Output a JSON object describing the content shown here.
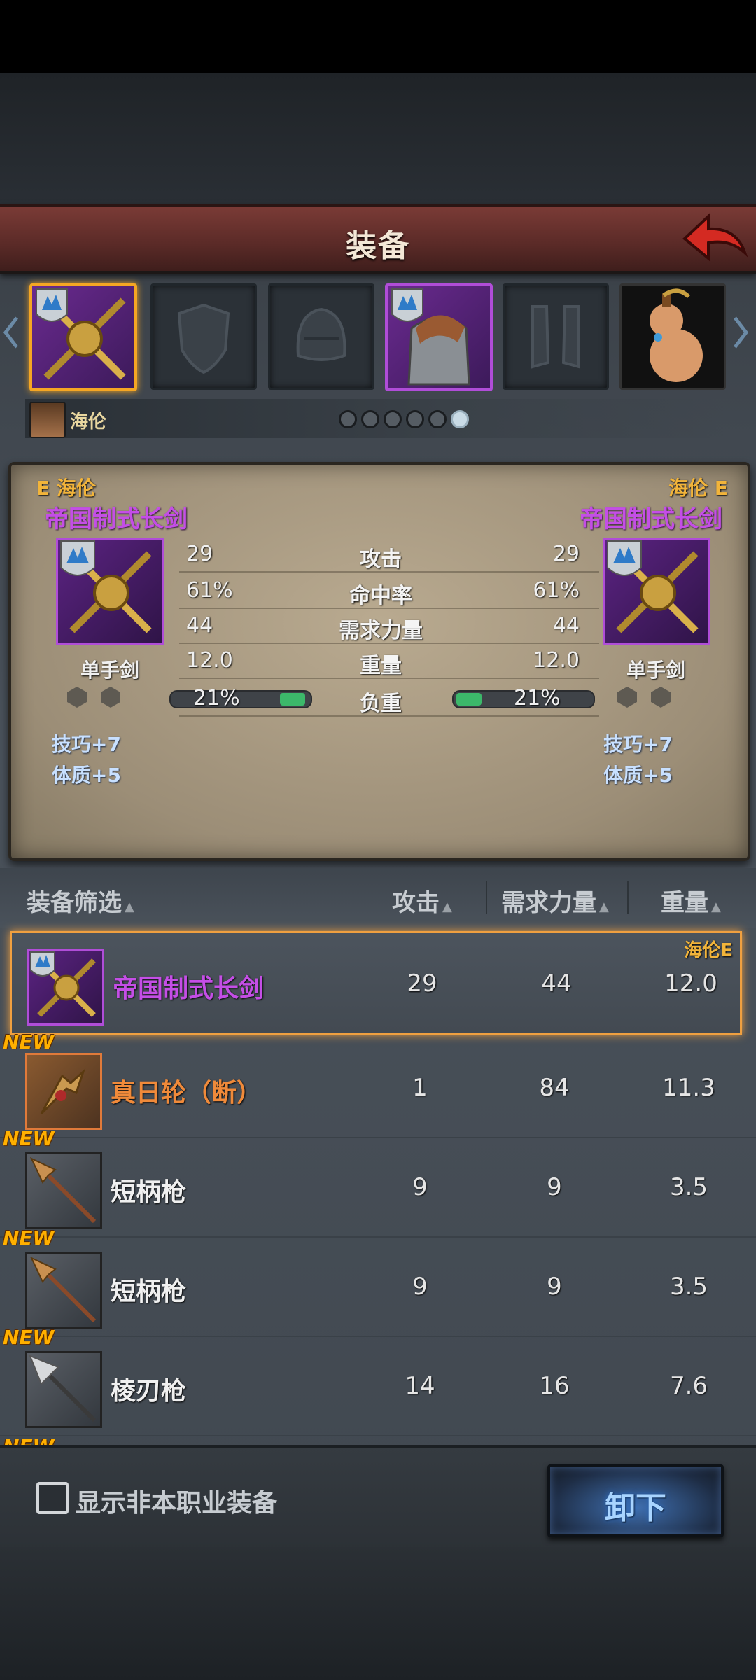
{
  "header": {
    "title": "装备"
  },
  "character": {
    "name": "海伦"
  },
  "pager": {
    "count": 6,
    "active": 5
  },
  "compare": {
    "left": {
      "tag": "E 海伦",
      "name": "帝国制式长剑",
      "type": "单手剑",
      "attack": "29",
      "hit": "61%",
      "str_req": "44",
      "weight": "12.0",
      "load": "21%",
      "bonus1": "技巧+7",
      "bonus2": "体质+5"
    },
    "right": {
      "tag": "海伦 E",
      "name": "帝国制式长剑",
      "type": "单手剑",
      "attack": "29",
      "hit": "61%",
      "str_req": "44",
      "weight": "12.0",
      "load": "21%",
      "bonus1": "技巧+7",
      "bonus2": "体质+5"
    },
    "labels": {
      "attack": "攻击",
      "hit": "命中率",
      "str_req": "需求力量",
      "weight": "重量",
      "load": "负重"
    }
  },
  "list_header": {
    "filter": "装备筛选",
    "attack": "攻击",
    "str_req": "需求力量",
    "weight": "重量"
  },
  "items": [
    {
      "name": "帝国制式长剑",
      "attack": "29",
      "str_req": "44",
      "weight": "12.0",
      "tag": "海伦E"
    },
    {
      "name": "真日轮（断）",
      "attack": "1",
      "str_req": "84",
      "weight": "11.3",
      "badge": "NEW"
    },
    {
      "name": "短柄枪",
      "attack": "9",
      "str_req": "9",
      "weight": "3.5",
      "badge": "NEW"
    },
    {
      "name": "短柄枪",
      "attack": "9",
      "str_req": "9",
      "weight": "3.5",
      "badge": "NEW"
    },
    {
      "name": "棱刃枪",
      "attack": "14",
      "str_req": "16",
      "weight": "7.6",
      "badge": "NEW"
    },
    {
      "badge": "NEW"
    }
  ],
  "bottom": {
    "checkbox_label": "显示非本职业装备",
    "unequip": "卸下"
  },
  "colors": {
    "rare_purple": "#c44ee6",
    "legend_orange": "#f08a3a",
    "select_gold": "#f0a040",
    "new_badge": "#ffb000"
  },
  "icons": [
    "back-arrow-icon",
    "sword-icon",
    "shield-icon",
    "helmet-icon",
    "armor-icon",
    "boots-icon",
    "gourd-icon",
    "spear-icon",
    "gem-socket-icon"
  ]
}
